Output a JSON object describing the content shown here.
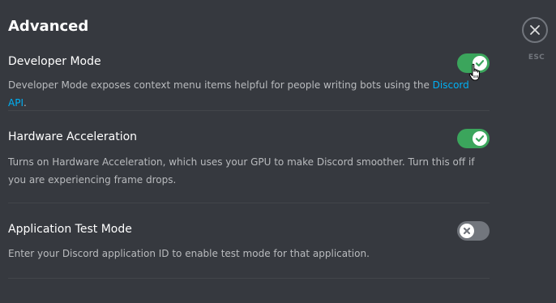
{
  "page": {
    "title": "Advanced"
  },
  "settings": [
    {
      "title": "Developer Mode",
      "description": "Developer Mode exposes context menu items helpful for people writing bots using the ",
      "link_text": "Discord API",
      "description_end": ".",
      "enabled": true
    },
    {
      "title": "Hardware Acceleration",
      "description": "Turns on Hardware Acceleration, which uses your GPU to make Discord smoother. Turn this off if you are experiencing frame drops.",
      "enabled": true
    },
    {
      "title": "Application Test Mode",
      "description": "Enter your Discord application ID to enable test mode for that application.",
      "enabled": false
    }
  ],
  "close": {
    "label": "ESC",
    "icon": "close-icon"
  },
  "colors": {
    "background": "#36393f",
    "toggle_on": "#3ba55c",
    "toggle_off": "#72767d",
    "link": "#00b0f4"
  }
}
